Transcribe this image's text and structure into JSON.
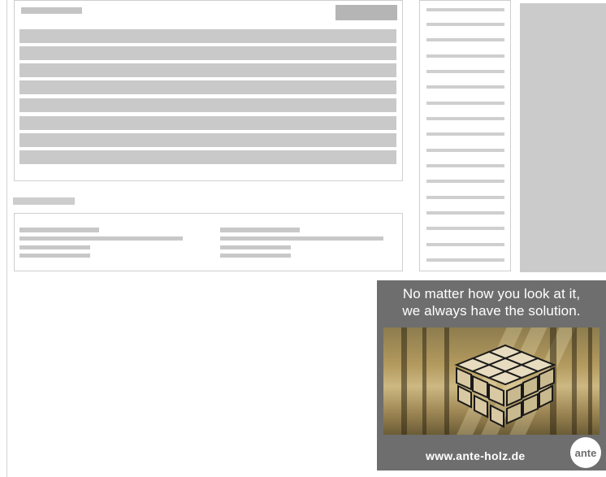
{
  "advertisement": {
    "headline_line1": "No matter how you look at it,",
    "headline_line2": "we always have the solution.",
    "url": "www.ante-holz.de",
    "logo_text": "ante",
    "image_icon": "rubiks-cube-forest-icon"
  },
  "colors": {
    "placeholder_gray": "#c9c9c9",
    "border_gray": "#cfcfcf",
    "ad_background": "#6e6e6e",
    "ad_text": "#ffffff"
  }
}
